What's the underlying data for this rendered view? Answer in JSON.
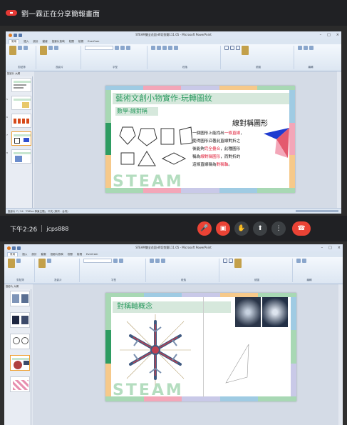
{
  "meet": {
    "banner_text": "劉一霖正在分享簡報畫面",
    "time": "下午2:26",
    "meeting_code": "jcps888"
  },
  "powerpoint": {
    "window_title_1": "STEAM雙全花園-師切剪築111.05 - Microsoft PowerPoint",
    "window_title_2": "STEAM雙全花園-師切剪築111.05 - Microsoft PowerPoint",
    "tabs": [
      "常用",
      "插入",
      "設計",
      "動畫",
      "投影片放映",
      "校閱",
      "檢視",
      "EverCam"
    ],
    "groups": [
      "剪貼簿",
      "投影片",
      "字型",
      "段落",
      "繪圖",
      "編輯"
    ],
    "outline_tab": "投影片 大綱",
    "status_text": "投影片 7 / 24   「Office 佈景主題」   中文 (臺灣 - 台灣)"
  },
  "slide1": {
    "title": "藝術文創小物實作-玩轉圖紋",
    "subtitle": "數學-線對稱",
    "callout": "線對稱圖形",
    "body": [
      [
        {
          "t": "一個圖形上能找出",
          "c": ""
        },
        {
          "t": "一條直線",
          "c": "red"
        },
        {
          "t": "，",
          "c": ""
        }
      ],
      [
        {
          "t": "使得圖形沿著此直線對折之",
          "c": ""
        }
      ],
      [
        {
          "t": "後能夠",
          "c": ""
        },
        {
          "t": "完全疊合",
          "c": "red"
        },
        {
          "t": "，此種圖形",
          "c": ""
        }
      ],
      [
        {
          "t": "稱為",
          "c": ""
        },
        {
          "t": "線對稱圖形",
          "c": "red"
        },
        {
          "t": "，而對折的",
          "c": ""
        }
      ],
      [
        {
          "t": "這條直線稱為",
          "c": ""
        },
        {
          "t": "對稱軸",
          "c": "red"
        },
        {
          "t": "。",
          "c": ""
        }
      ]
    ],
    "steam": "STEAM"
  },
  "slide2": {
    "title": "對稱軸概念",
    "steam": "STEAM"
  },
  "colors": {
    "red_text": "#e0203a",
    "title_bg": "#d6e8dc",
    "green": "#2e9c62",
    "blue": "#1f3bd0"
  }
}
